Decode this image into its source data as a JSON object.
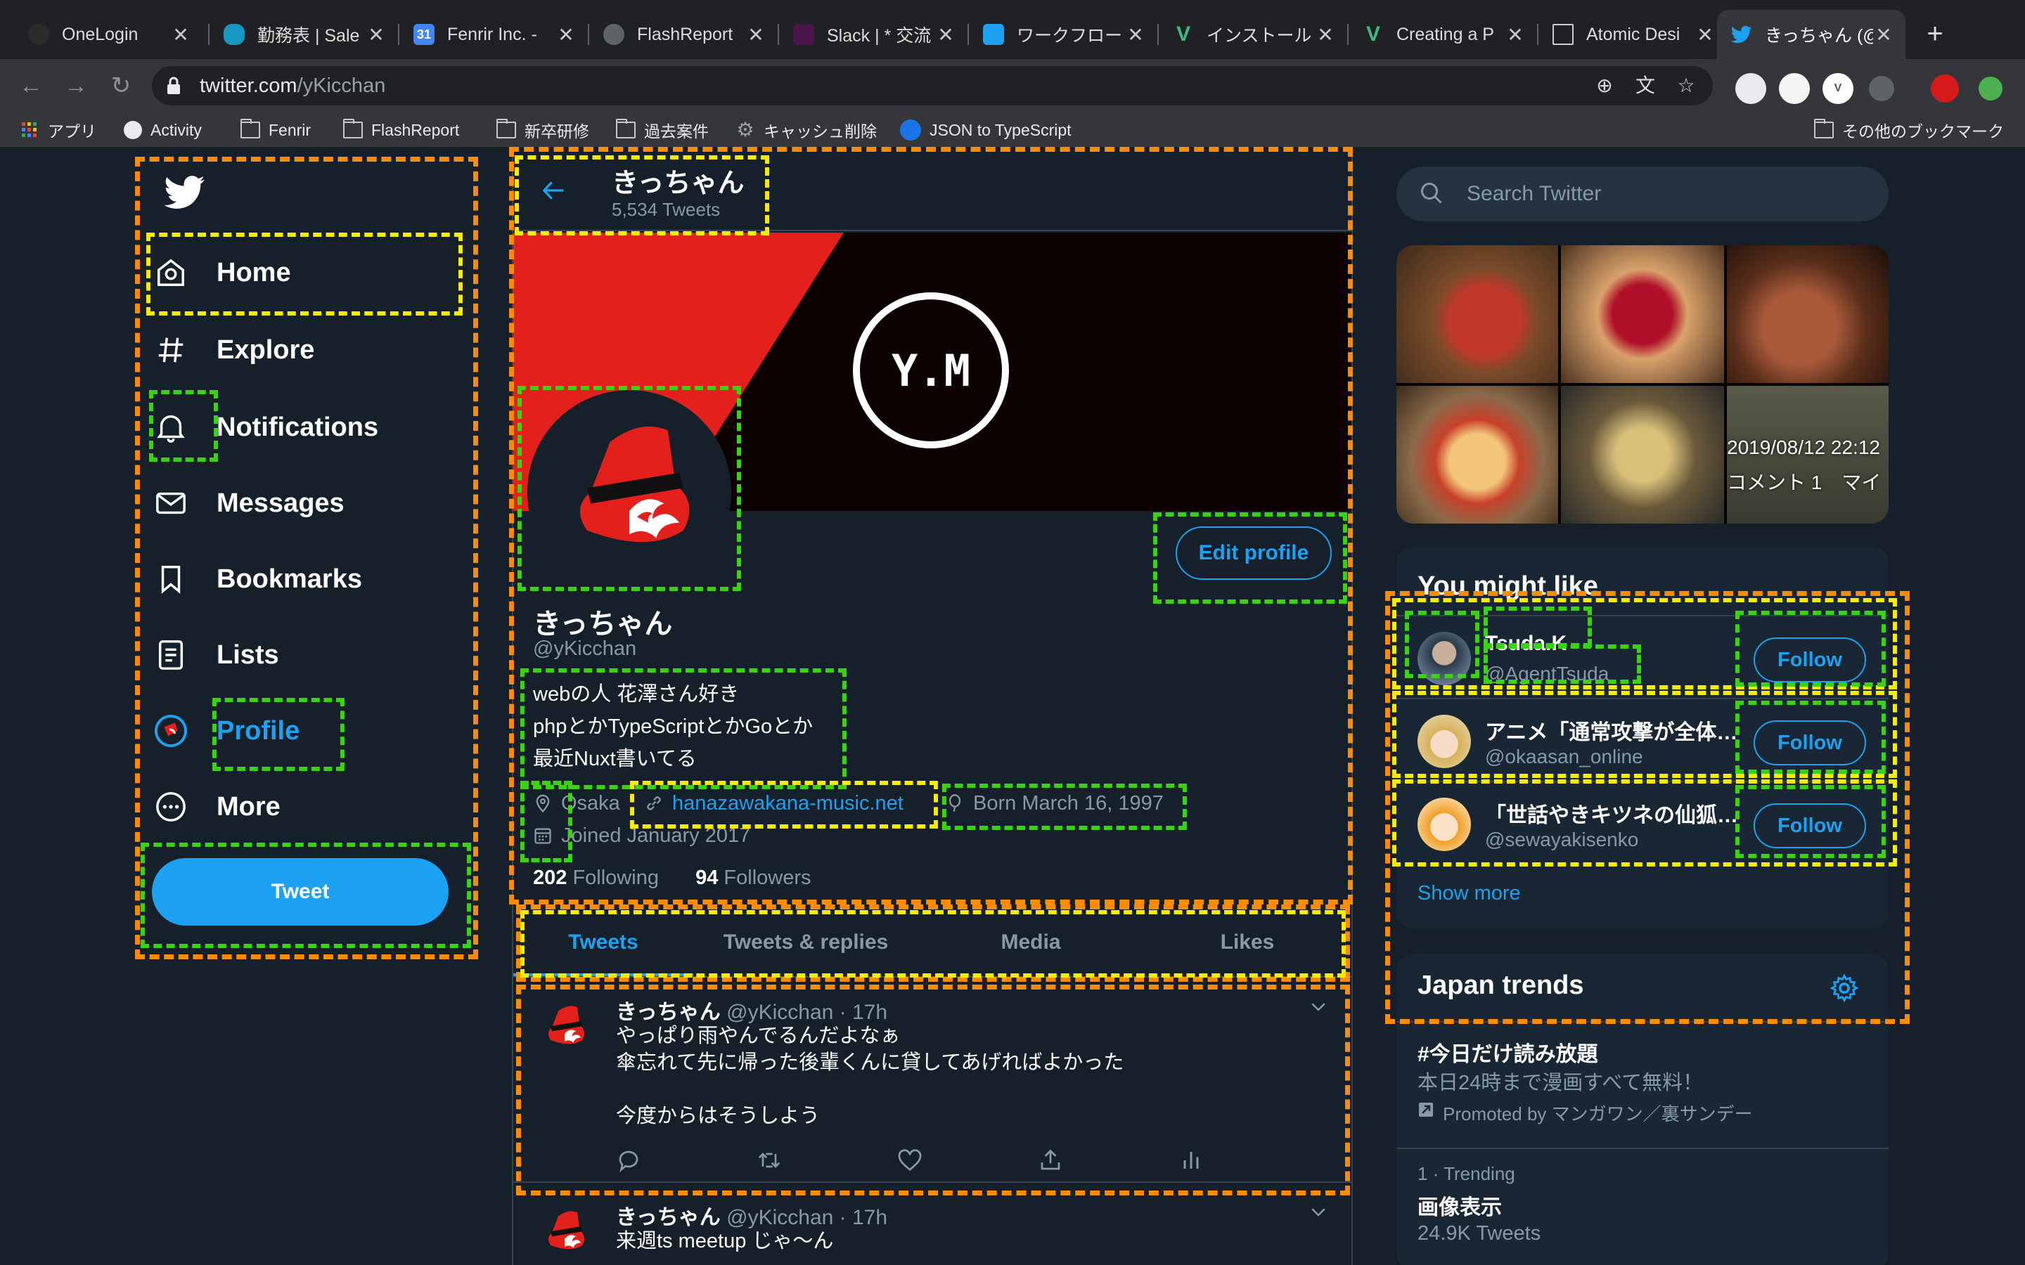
{
  "browser": {
    "tabs": [
      {
        "title": "OneLogin",
        "color": "#2b2b2b"
      },
      {
        "title": "勤務表 | Sale",
        "color": "#1798c1"
      },
      {
        "title": "Fenrir Inc. -",
        "color": "#4285f4",
        "badge": "31"
      },
      {
        "title": "FlashReport",
        "color": "#5f6368"
      },
      {
        "title": "Slack | * 交流",
        "color": "#4a154b"
      },
      {
        "title": "ワークフロー",
        "color": "#1da1f2"
      },
      {
        "title": "インストール",
        "color": "#41b883"
      },
      {
        "title": "Creating a P",
        "color": "#41b883"
      },
      {
        "title": "Atomic Desi",
        "color": "#5f6368"
      },
      {
        "title": "きっちゃん (@",
        "color": "#1da1f2"
      }
    ],
    "url_host": "twitter.com",
    "url_path": "/yKicchan",
    "bookmarks": [
      "アプリ",
      "Activity",
      "Fenrir",
      "FlashReport",
      "新卒研修",
      "過去案件",
      "キャッシュ削除",
      "JSON to TypeScript"
    ],
    "other_bookmarks": "その他のブックマーク"
  },
  "nav": {
    "items": [
      {
        "label": "Home",
        "icon": "home-icon"
      },
      {
        "label": "Explore",
        "icon": "hashtag-icon"
      },
      {
        "label": "Notifications",
        "icon": "bell-icon"
      },
      {
        "label": "Messages",
        "icon": "envelope-icon"
      },
      {
        "label": "Bookmarks",
        "icon": "bookmark-icon"
      },
      {
        "label": "Lists",
        "icon": "list-icon"
      },
      {
        "label": "Profile",
        "icon": "avatar"
      },
      {
        "label": "More",
        "icon": "more-icon"
      }
    ],
    "tweet_button": "Tweet"
  },
  "header": {
    "name": "きっちゃん",
    "tweet_count": "5,534 Tweets"
  },
  "banner": {
    "logo_text": "Y.M"
  },
  "profile": {
    "name": "きっちゃん",
    "handle": "@yKicchan",
    "bio": [
      "webの人 花澤さん好き",
      "phpとかTypeScriptとかGoとか",
      "最近Nuxt書いてる"
    ],
    "location": "Osaka",
    "website": "hanazawakana-music.net",
    "birthday": "Born March 16, 1997",
    "joined": "Joined January 2017",
    "following_count": "202",
    "following_label": "Following",
    "followers_count": "94",
    "followers_label": "Followers",
    "edit_button": "Edit profile"
  },
  "profile_tabs": [
    "Tweets",
    "Tweets & replies",
    "Media",
    "Likes"
  ],
  "tweets": [
    {
      "name": "きっちゃん",
      "meta": "@yKicchan · 17h",
      "text": "やっぱり雨やんでるんだよなぁ\n傘忘れて先に帰った後輩くんに貸してあげればよかった\n\n今度からはそうしよう"
    },
    {
      "name": "きっちゃん",
      "meta": "@yKicchan · 17h",
      "text": "来週ts meetup じゃ〜ん"
    }
  ],
  "search": {
    "placeholder": "Search Twitter"
  },
  "photos": {
    "timestamp": "2019/08/12 22:12",
    "caption": "コメント 1　マイ"
  },
  "suggestions": {
    "title": "You might like",
    "users": [
      {
        "name": "Tsuda.K",
        "handle": "@AgentTsuda",
        "button": "Follow"
      },
      {
        "name": "アニメ「通常攻撃が全体攻撃で二回攻撃のお母さんは好きですか？」",
        "handle": "@okaasan_online",
        "button": "Follow"
      },
      {
        "name": "「世話やきキツネの仙狐さん」",
        "handle": "@sewayakisenko",
        "button": "Follow"
      }
    ],
    "show_more": "Show more"
  },
  "trends": {
    "title": "Japan trends",
    "promoted": {
      "tag": "#今日だけ読み放題",
      "desc": "本日24時まで漫画すべて無料！",
      "by": "Promoted by マンガワン／裏サンデー"
    },
    "items": [
      {
        "meta": "1 · Trending",
        "name": "画像表示",
        "count": "24.9K Tweets"
      }
    ]
  },
  "colors": {
    "background": "#15202b",
    "accent": "#1da1f2",
    "panel": "#192734",
    "border": "#38444d",
    "muted": "#8899a6"
  }
}
